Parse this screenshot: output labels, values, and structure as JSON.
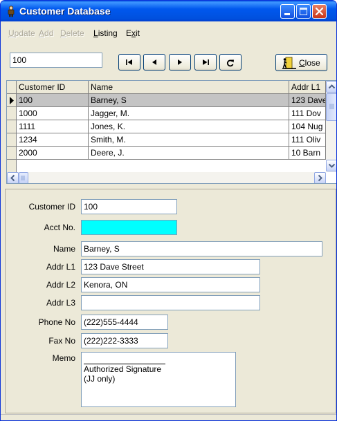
{
  "window": {
    "title": "Customer Database",
    "icon": "person-icon"
  },
  "menu": [
    {
      "label": "Update",
      "enabled": false
    },
    {
      "label": "Add",
      "enabled": false
    },
    {
      "label": "Delete",
      "enabled": false
    },
    {
      "label": "Listing",
      "enabled": true
    },
    {
      "label": "Exit",
      "enabled": true
    }
  ],
  "toolbar": {
    "search_value": "100",
    "nav_icons": [
      "first-record-icon",
      "previous-record-icon",
      "next-record-icon",
      "last-record-icon",
      "refresh-icon"
    ],
    "close_label": "Close"
  },
  "grid": {
    "columns": [
      "Customer ID",
      "Name",
      "Addr L1"
    ],
    "rows": [
      {
        "id": "100",
        "name": "Barney, S",
        "addr": "123 Dave",
        "current": true
      },
      {
        "id": "1000",
        "name": "Jagger, M.",
        "addr": "111 Dov",
        "current": false
      },
      {
        "id": "1111",
        "name": "Jones, K.",
        "addr": "104 Nug",
        "current": false
      },
      {
        "id": "1234",
        "name": "Smith, M.",
        "addr": "111 Oliv",
        "current": false
      },
      {
        "id": "2000",
        "name": "Deere, J.",
        "addr": "10 Barn",
        "current": false
      }
    ]
  },
  "form": {
    "customer_id_label": "Customer ID",
    "customer_id": "100",
    "acct_no_label": "Acct No.",
    "acct_no": "",
    "name_label": "Name",
    "name": "Barney, S",
    "addr1_label": "Addr L1",
    "addr1": "123 Dave Street",
    "addr2_label": "Addr L2",
    "addr2": "Kenora, ON",
    "addr3_label": "Addr L3",
    "addr3": "",
    "phone_label": "Phone No",
    "phone": "(222)555-4444",
    "fax_label": "Fax No",
    "fax": "(222)222-3333",
    "memo_label": "Memo",
    "memo": "Authorized Signature  (JJ only)"
  },
  "colors": {
    "acct_field_bg": "#00ffff",
    "title_bar": "#0054e3",
    "selected_row": "#c4c4c4"
  }
}
